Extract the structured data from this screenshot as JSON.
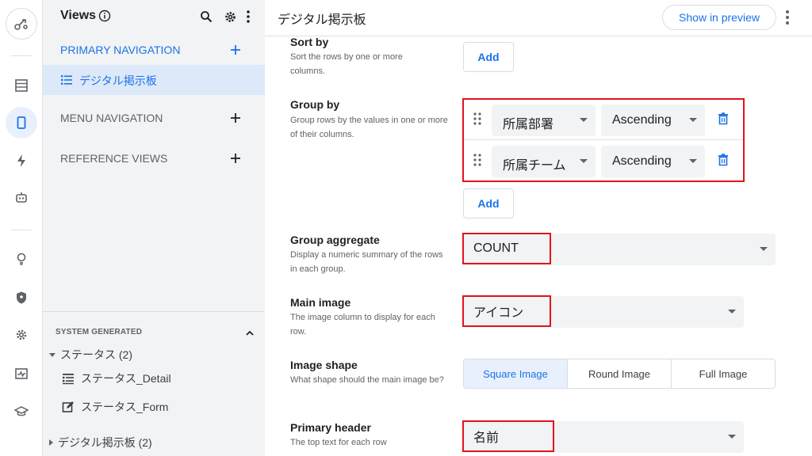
{
  "sidebar": {
    "title": "Views",
    "primary_nav_label": "PRIMARY NAVIGATION",
    "active_view_label": "デジタル掲示板",
    "menu_nav_label": "MENU NAVIGATION",
    "reference_views_label": "REFERENCE VIEWS",
    "system_generated_label": "SYSTEM GENERATED",
    "tree": {
      "status_group": "ステータス (2)",
      "status_detail": "ステータス_Detail",
      "status_form": "ステータス_Form",
      "board_group": "デジタル掲示板 (2)"
    }
  },
  "main": {
    "title": "デジタル掲示板",
    "preview_label": "Show in preview",
    "sort_by": {
      "title": "Sort by",
      "desc": "Sort the rows by one or more columns.",
      "add_label": "Add"
    },
    "group_by": {
      "title": "Group by",
      "desc": "Group rows by the values in one or more of their columns.",
      "rows": [
        {
          "column": "所属部署",
          "order": "Ascending"
        },
        {
          "column": "所属チーム",
          "order": "Ascending"
        }
      ],
      "add_label": "Add"
    },
    "group_aggregate": {
      "title": "Group aggregate",
      "desc": "Display a numeric summary of the rows in each group.",
      "value": "COUNT"
    },
    "main_image": {
      "title": "Main image",
      "desc": "The image column to display for each row.",
      "value": "アイコン"
    },
    "image_shape": {
      "title": "Image shape",
      "desc": "What shape should the main image be?",
      "options": [
        "Square Image",
        "Round Image",
        "Full Image"
      ],
      "selected": "Square Image"
    },
    "primary_header": {
      "title": "Primary header",
      "desc": "The top text for each row",
      "value": "名前"
    }
  },
  "colors": {
    "accent": "#1a73e8",
    "highlight_border": "#e0141e",
    "sidebar_bg": "#f1f3f4",
    "active_item_bg": "#dde8f8"
  },
  "icons": {
    "rail": [
      "logo-icon",
      "data-icon",
      "app-icon",
      "automation-icon",
      "bot-icon",
      "idea-icon",
      "security-icon",
      "settings-icon",
      "monitor-icon",
      "learn-icon"
    ]
  }
}
